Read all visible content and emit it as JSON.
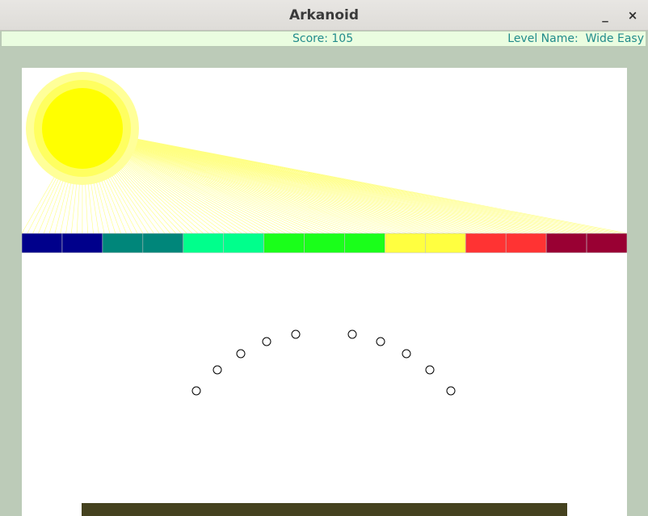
{
  "window": {
    "title": "Arkanoid",
    "minimize_label": "_",
    "close_label": "×"
  },
  "status": {
    "score_label": "Score:",
    "score": 105,
    "level_label": "Level Name:",
    "level_name": "Wide Easy"
  },
  "colors": {
    "background": "#bccbb8",
    "status_bg": "#eafde0",
    "status_text": "#218b8b",
    "field": "#ffffff",
    "sun_outer": "#ffff99",
    "sun_middle": "#ffff60",
    "sun_core": "#ffff00",
    "rays": "#ffff80",
    "paddle": "#45421f",
    "ball_stroke": "#000000"
  },
  "blocks": [
    {
      "color": "#00008b"
    },
    {
      "color": "#00008b"
    },
    {
      "color": "#00867a"
    },
    {
      "color": "#00867a"
    },
    {
      "color": "#00ff8c"
    },
    {
      "color": "#00ff8c"
    },
    {
      "color": "#1aff1a"
    },
    {
      "color": "#1aff1a"
    },
    {
      "color": "#1aff1a"
    },
    {
      "color": "#ffff40"
    },
    {
      "color": "#ffff40"
    },
    {
      "color": "#ff3333"
    },
    {
      "color": "#ff3333"
    },
    {
      "color": "#990033"
    },
    {
      "color": "#990033"
    }
  ],
  "balls_count": 10
}
